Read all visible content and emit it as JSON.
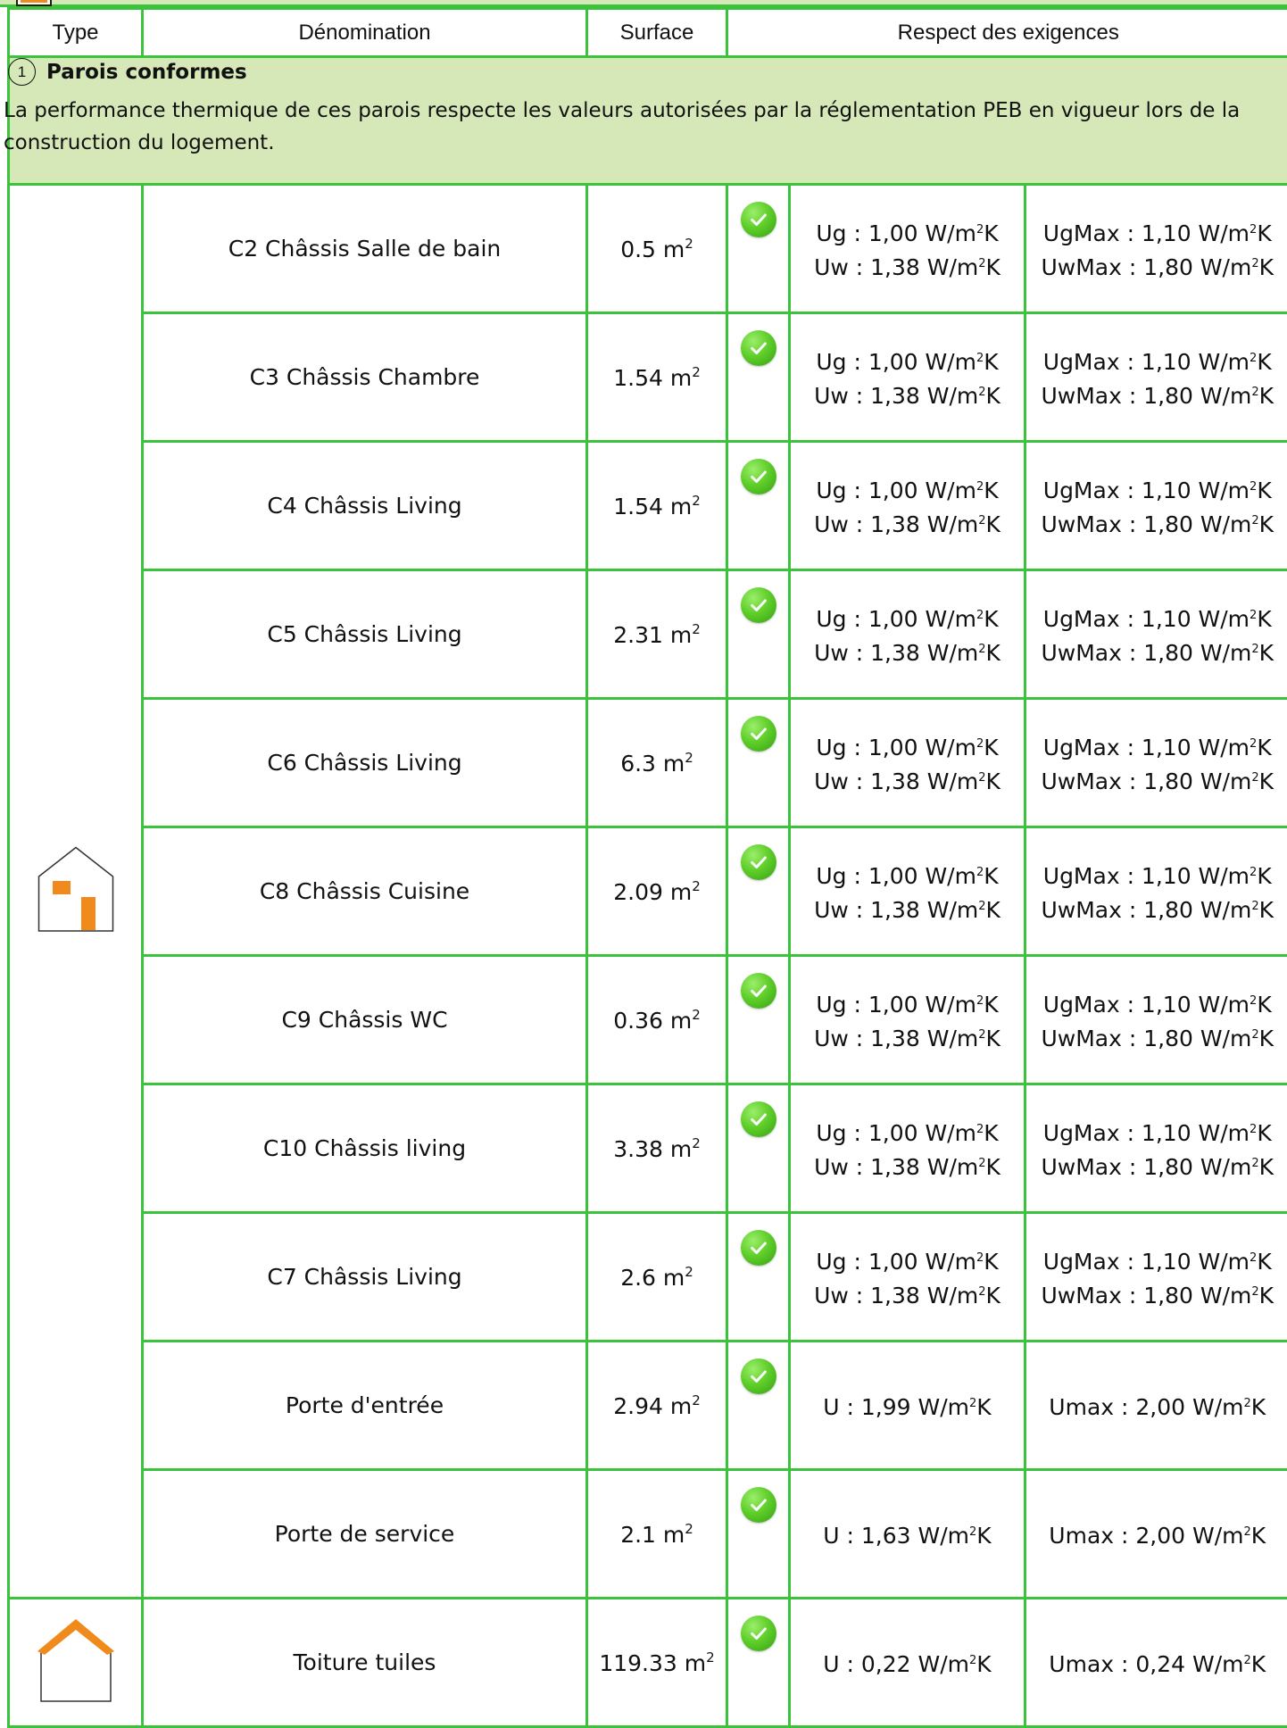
{
  "header": {
    "type": "Type",
    "denomination": "Dénomination",
    "surface": "Surface",
    "respect": "Respect des exigences"
  },
  "section": {
    "number": "1",
    "title": "Parois conformes",
    "description": "La performance thermique de ces parois respecte les valeurs autorisées par la réglementation PEB en vigueur lors de la construction du logement."
  },
  "colors": {
    "border": "#3cc33c",
    "section_bg": "#d6e8b8",
    "accent": "#f08a1c",
    "check": "#5fcf2a"
  },
  "icons": {
    "window_type": "house-window-icon",
    "roof_type": "house-roof-icon",
    "status": "green-check-icon"
  },
  "groups": [
    {
      "icon": "house-window-icon",
      "rows": [
        {
          "name": "C2 Châssis Salle de bain",
          "surface": "0.5 m",
          "v1": "Ug : 1,00 W/m²K",
          "v2": "Uw : 1,38 W/m²K",
          "m1": "UgMax : 1,10 W/m²K",
          "m2": "UwMax : 1,80 W/m²K"
        },
        {
          "name": "C3 Châssis Chambre",
          "surface": "1.54 m",
          "v1": "Ug : 1,00 W/m²K",
          "v2": "Uw : 1,38 W/m²K",
          "m1": "UgMax : 1,10 W/m²K",
          "m2": "UwMax : 1,80 W/m²K"
        },
        {
          "name": "C4 Châssis Living",
          "surface": "1.54 m",
          "v1": "Ug : 1,00 W/m²K",
          "v2": "Uw : 1,38 W/m²K",
          "m1": "UgMax : 1,10 W/m²K",
          "m2": "UwMax : 1,80 W/m²K"
        },
        {
          "name": "C5 Châssis Living",
          "surface": "2.31 m",
          "v1": "Ug : 1,00 W/m²K",
          "v2": "Uw : 1,38 W/m²K",
          "m1": "UgMax : 1,10 W/m²K",
          "m2": "UwMax : 1,80 W/m²K"
        },
        {
          "name": "C6 Châssis Living",
          "surface": "6.3 m",
          "v1": "Ug : 1,00 W/m²K",
          "v2": "Uw : 1,38 W/m²K",
          "m1": "UgMax : 1,10 W/m²K",
          "m2": "UwMax : 1,80 W/m²K"
        },
        {
          "name": "C8 Châssis Cuisine",
          "surface": "2.09 m",
          "v1": "Ug : 1,00 W/m²K",
          "v2": "Uw : 1,38 W/m²K",
          "m1": "UgMax : 1,10 W/m²K",
          "m2": "UwMax : 1,80 W/m²K"
        },
        {
          "name": "C9 Châssis WC",
          "surface": "0.36 m",
          "v1": "Ug : 1,00 W/m²K",
          "v2": "Uw : 1,38 W/m²K",
          "m1": "UgMax : 1,10 W/m²K",
          "m2": "UwMax : 1,80 W/m²K"
        },
        {
          "name": "C10 Châssis living",
          "surface": "3.38 m",
          "v1": "Ug : 1,00 W/m²K",
          "v2": "Uw : 1,38 W/m²K",
          "m1": "UgMax : 1,10 W/m²K",
          "m2": "UwMax : 1,80 W/m²K"
        },
        {
          "name": "C7 Châssis Living",
          "surface": "2.6 m",
          "v1": "Ug : 1,00 W/m²K",
          "v2": "Uw : 1,38 W/m²K",
          "m1": "UgMax : 1,10 W/m²K",
          "m2": "UwMax : 1,80 W/m²K"
        },
        {
          "name": "Porte d'entrée",
          "surface": "2.94 m",
          "v1": "U : 1,99 W/m²K",
          "v2": "",
          "m1": "Umax : 2,00 W/m²K",
          "m2": ""
        },
        {
          "name": "Porte de service",
          "surface": "2.1 m",
          "v1": "U : 1,63 W/m²K",
          "v2": "",
          "m1": "Umax : 2,00 W/m²K",
          "m2": ""
        }
      ]
    },
    {
      "icon": "house-roof-icon",
      "rows": [
        {
          "name": "Toiture tuiles",
          "surface": "119.33 m",
          "v1": "U : 0,22 W/m²K",
          "v2": "",
          "m1": "Umax : 0,24 W/m²K",
          "m2": ""
        }
      ]
    }
  ],
  "surface_unit_exponent": "2"
}
